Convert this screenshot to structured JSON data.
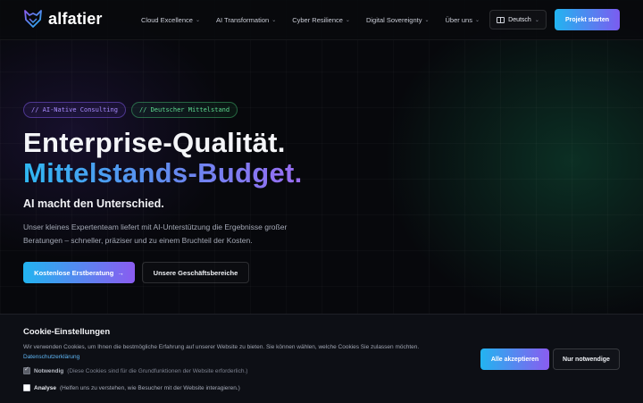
{
  "brand": {
    "name": "alfatier",
    "logo_icon": "wolf-logo-icon"
  },
  "nav": {
    "items": [
      {
        "label": "Cloud Excellence",
        "icon": "chevron-down-icon"
      },
      {
        "label": "AI Transformation",
        "icon": "chevron-down-icon"
      },
      {
        "label": "Cyber Resilience",
        "icon": "chevron-down-icon"
      },
      {
        "label": "Digital Sovereignty",
        "icon": "chevron-down-icon"
      },
      {
        "label": "Über uns",
        "icon": "chevron-down-icon"
      }
    ],
    "language": {
      "label": "Deutsch",
      "icon": "book-icon"
    },
    "cta_label": "Projekt starten"
  },
  "hero": {
    "tags": [
      "// AI-Native Consulting",
      "// Deutscher Mittelstand"
    ],
    "title_line1": "Enterprise-Qualität.",
    "title_line2": "Mittelstands-Budget.",
    "subtitle": "AI macht den Unterschied.",
    "description": "Unser kleines Expertenteam liefert mit AI-Unterstützung die Ergebnisse großer Beratungen – schneller, präziser und zu einem Bruchteil der Kosten.",
    "primary_button": "Kostenlose Erstberatung",
    "primary_arrow": "→",
    "secondary_button": "Unsere Geschäftsbereiche"
  },
  "cookie": {
    "title": "Cookie-Einstellungen",
    "text": "Wir verwenden Cookies, um Ihnen die bestmögliche Erfahrung auf unserer Website zu bieten. Sie können wählen, welche Cookies Sie zulassen möchten.",
    "link": "Datenschutzerklärung",
    "options": [
      {
        "name": "Notwendig",
        "desc": "(Diese Cookies sind für die Grundfunktionen der Website erforderlich.)",
        "checked": true
      },
      {
        "name": "Analyse",
        "desc": "(Helfen uns zu verstehen, wie Besucher mit der Website interagieren.)",
        "checked": false
      }
    ],
    "accept_all": "Alle akzeptieren",
    "only_necessary": "Nur notwendige"
  },
  "colors": {
    "accent_start": "#22b4f0",
    "accent_end": "#8a5cf0",
    "tag_purple": "#a98cff",
    "tag_green": "#5fd990",
    "background": "#07080c"
  }
}
